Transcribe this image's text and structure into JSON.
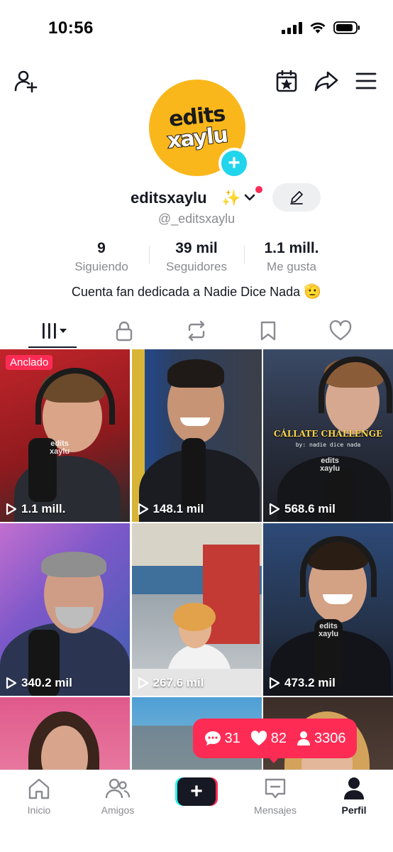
{
  "status_bar": {
    "time": "10:56"
  },
  "header": {
    "add_friend_icon": "person-plus-icon",
    "calendar_icon": "calendar-star-icon",
    "share_icon": "share-arrow-icon",
    "menu_icon": "hamburger-menu-icon"
  },
  "profile": {
    "avatar_text_line1": "edits",
    "avatar_text_line2": "xaylu",
    "display_name": "editsxaylu",
    "sparkle": "✨",
    "handle": "@_editsxaylu",
    "stats": [
      {
        "value": "9",
        "label": "Siguiendo"
      },
      {
        "value": "39 mil",
        "label": "Seguidores"
      },
      {
        "value": "1.1 mill.",
        "label": "Me gusta"
      }
    ],
    "bio": "Cuenta fan dedicada a Nadie Dice Nada",
    "bio_emoji": "🫡"
  },
  "tabs": [
    {
      "name": "videos",
      "icon": "grid-bars-icon",
      "active": true
    },
    {
      "name": "private",
      "icon": "lock-icon",
      "active": false
    },
    {
      "name": "reposts",
      "icon": "repost-icon",
      "active": false
    },
    {
      "name": "favorites",
      "icon": "bookmark-icon",
      "active": false
    },
    {
      "name": "liked",
      "icon": "heart-icon",
      "active": false
    }
  ],
  "videos": [
    {
      "views": "1.1 mill.",
      "pinned_label": "Anclado"
    },
    {
      "views": "148.1 mil"
    },
    {
      "views": "568.6 mil",
      "caption": "CÁLLATE CHALLENGE",
      "caption2": "by: nadie dice nada"
    },
    {
      "views": "340.2 mil"
    },
    {
      "views": "267.6 mil"
    },
    {
      "views": "473.2 mil"
    },
    {
      "views": ""
    },
    {
      "views": ""
    },
    {
      "views": ""
    }
  ],
  "watermark": {
    "line1": "edits",
    "line2": "xaylu"
  },
  "live_bubble": {
    "comments": "31",
    "likes": "82",
    "followers": "3306"
  },
  "bottom_nav": [
    {
      "label": "Inicio",
      "icon": "home-icon"
    },
    {
      "label": "Amigos",
      "icon": "friends-icon"
    },
    {
      "label": "",
      "icon": "create-plus-icon"
    },
    {
      "label": "Mensajes",
      "icon": "inbox-icon"
    },
    {
      "label": "Perfil",
      "icon": "profile-icon"
    }
  ],
  "colors": {
    "brand_red": "#fe2c55",
    "brand_cyan": "#25f4ee",
    "avatar_yellow": "#f9b71b",
    "text_primary": "#161823",
    "text_secondary": "#8a8b91"
  }
}
